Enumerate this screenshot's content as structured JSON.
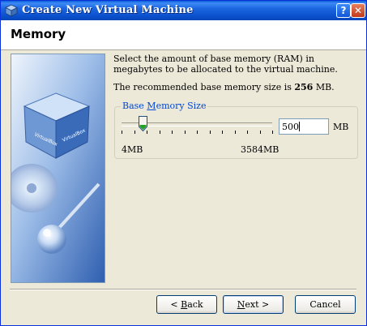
{
  "window": {
    "title": "Create New Virtual Machine",
    "help_label": "?",
    "close_label": "✕"
  },
  "header": {
    "title": "Memory"
  },
  "content": {
    "description": "Select the amount of base memory (RAM) in megabytes to be allocated to the virtual machine.",
    "recommended_prefix": "The recommended base memory size is ",
    "recommended_value": "256",
    "recommended_suffix": " MB."
  },
  "memory_group": {
    "legend_prefix": "Base ",
    "legend_accel": "M",
    "legend_suffix": "emory Size",
    "value": "500",
    "unit": "MB",
    "min_label": "4MB",
    "max_label": "3584MB",
    "slider_min": 4,
    "slider_max": 3584,
    "slider_value": 500
  },
  "buttons": {
    "back_prefix": "< ",
    "back_accel": "B",
    "back_suffix": "ack",
    "next_accel": "N",
    "next_suffix": "ext >",
    "cancel": "Cancel"
  }
}
